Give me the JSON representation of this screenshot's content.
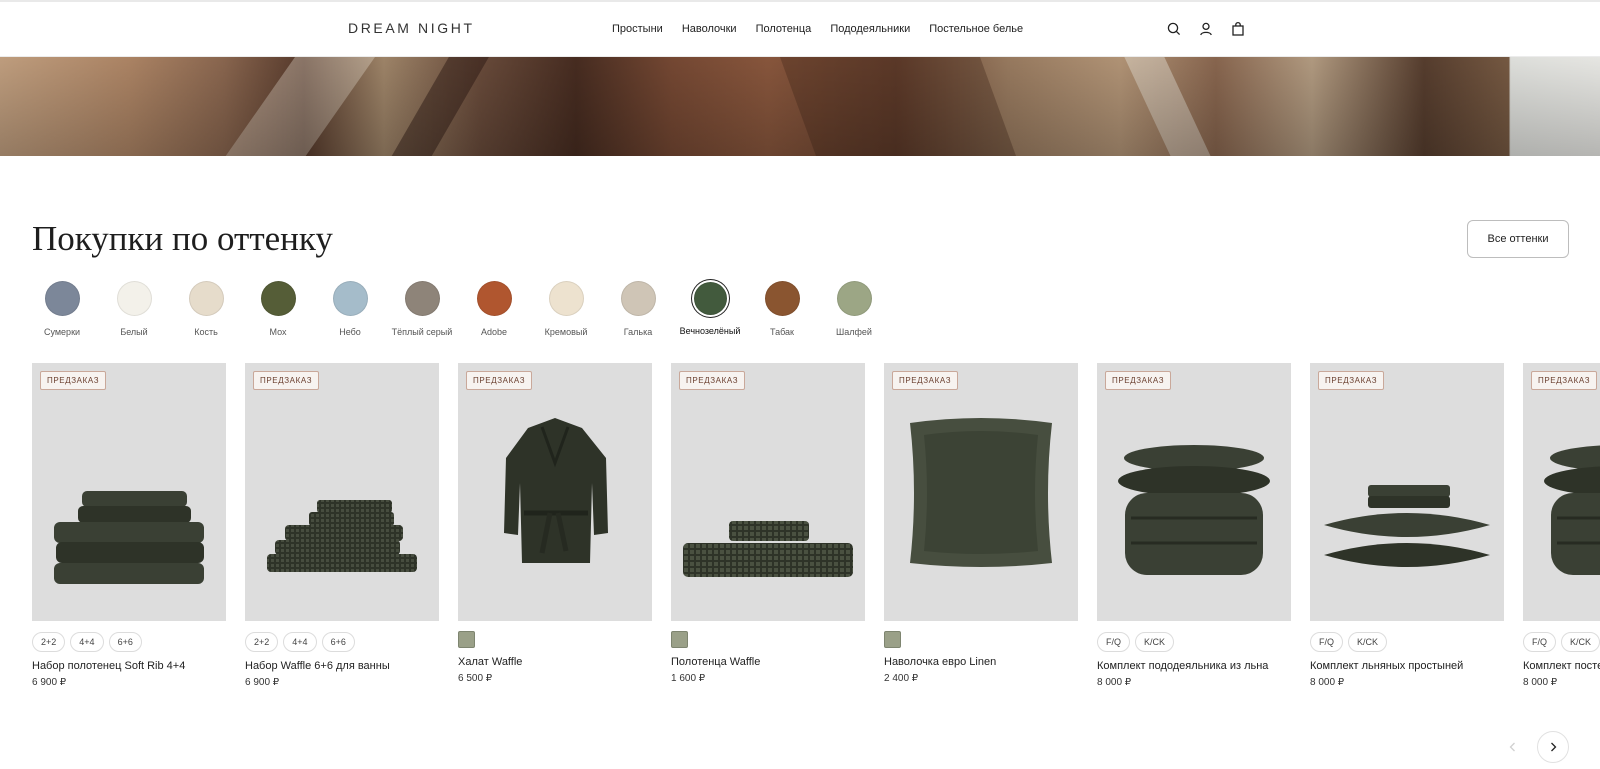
{
  "header": {
    "logo": "DREAM NIGHT",
    "nav": [
      "Простыни",
      "Наволочки",
      "Полотенца",
      "Пододеяльники",
      "Постельное белье"
    ],
    "icons": [
      "search-icon",
      "account-icon",
      "bag-icon"
    ]
  },
  "section": {
    "title": "Покупки по оттенку",
    "all_button": "Все оттенки"
  },
  "swatches": [
    {
      "label": "Сумерки",
      "color": "#7c8799"
    },
    {
      "label": "Белый",
      "color": "#f3f1ea"
    },
    {
      "label": "Кость",
      "color": "#e6dccb"
    },
    {
      "label": "Мох",
      "color": "#555d37"
    },
    {
      "label": "Небо",
      "color": "#a5bcca"
    },
    {
      "label": "Тёплый серый",
      "color": "#8e8479"
    },
    {
      "label": "Adobe",
      "color": "#b0562f"
    },
    {
      "label": "Кремовый",
      "color": "#ede2cf"
    },
    {
      "label": "Галька",
      "color": "#cfc5b6"
    },
    {
      "label": "Вечнозелёный",
      "color": "#425a3d",
      "selected": true
    },
    {
      "label": "Табак",
      "color": "#8a5530"
    },
    {
      "label": "Шалфей",
      "color": "#9ca685"
    }
  ],
  "products": [
    {
      "badge": "ПРЕДЗАКАЗ",
      "chips": [
        "2+2",
        "4+4",
        "6+6"
      ],
      "name": "Набор полотенец Soft Rib 4+4",
      "price": "6 900 ₽",
      "art": "towels"
    },
    {
      "badge": "ПРЕДЗАКАЗ",
      "chips": [
        "2+2",
        "4+4",
        "6+6"
      ],
      "name": "Набор Waffle 6+6 для ванны",
      "price": "6 900 ₽",
      "art": "waffle"
    },
    {
      "badge": "ПРЕДЗАКАЗ",
      "color_chip": "#9aa088",
      "name": "Халат Waffle",
      "price": "6 500 ₽",
      "art": "robe"
    },
    {
      "badge": "ПРЕДЗАКАЗ",
      "color_chip": "#9aa088",
      "name": "Полотенца Waffle",
      "price": "1 600 ₽",
      "art": "towel2"
    },
    {
      "badge": "ПРЕДЗАКАЗ",
      "color_chip": "#9aa088",
      "name": "Наволочка евро Linen",
      "price": "2 400 ₽",
      "art": "pillow"
    },
    {
      "badge": "ПРЕДЗАКАЗ",
      "chips": [
        "F/Q",
        "K/CK"
      ],
      "name": "Комплект пододеяльника из льна",
      "price": "8 000 ₽",
      "art": "duvet"
    },
    {
      "badge": "ПРЕДЗАКАЗ",
      "chips": [
        "F/Q",
        "K/CK"
      ],
      "name": "Комплект льняных простыней",
      "price": "8 000 ₽",
      "art": "sheets"
    },
    {
      "badge": "ПРЕДЗАКАЗ",
      "chips": [
        "F/Q",
        "K/CK"
      ],
      "name": "Комплект постельного белья из льна",
      "price": "8 000 ₽",
      "art": "duvet"
    }
  ],
  "carousel": {
    "prev_icon": "chevron-left-icon",
    "next_icon": "chevron-right-icon"
  }
}
